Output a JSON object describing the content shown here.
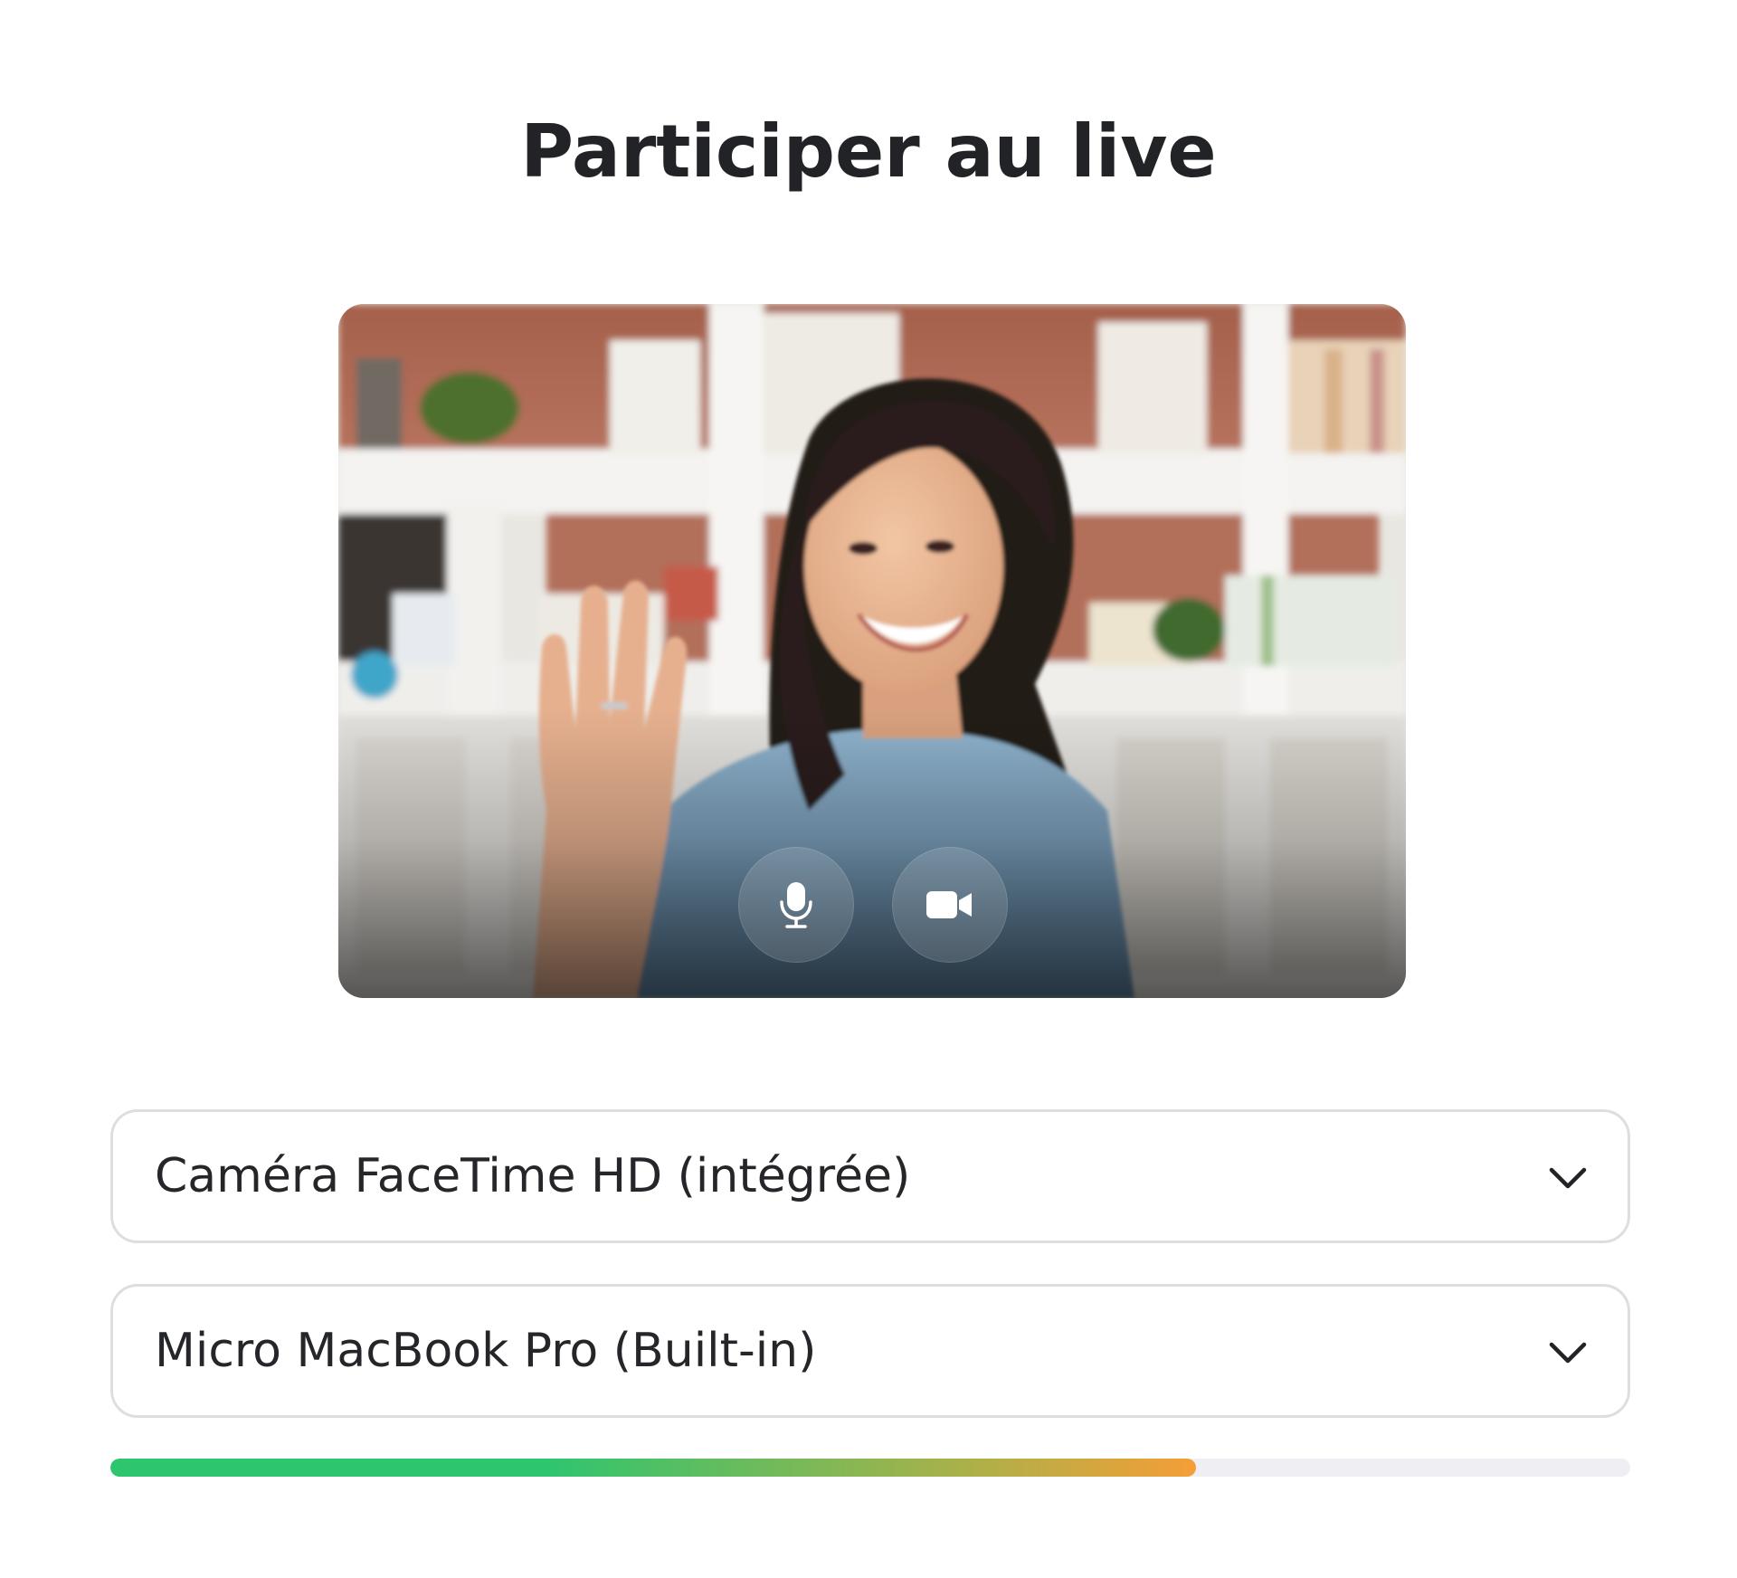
{
  "page": {
    "title": "Participer au live"
  },
  "preview": {
    "mic_button_icon": "microphone-icon",
    "camera_button_icon": "video-camera-icon"
  },
  "camera_select": {
    "value": "Caméra FaceTime HD (intégrée)",
    "icon": "chevron-down-icon"
  },
  "microphone_select": {
    "value": "Micro MacBook Pro (Built-in)",
    "icon": "chevron-down-icon"
  },
  "audio_level": {
    "fraction": 0.714,
    "color_start": "#2ec56f",
    "color_end": "#f59e36",
    "track_color": "#efeff3"
  }
}
